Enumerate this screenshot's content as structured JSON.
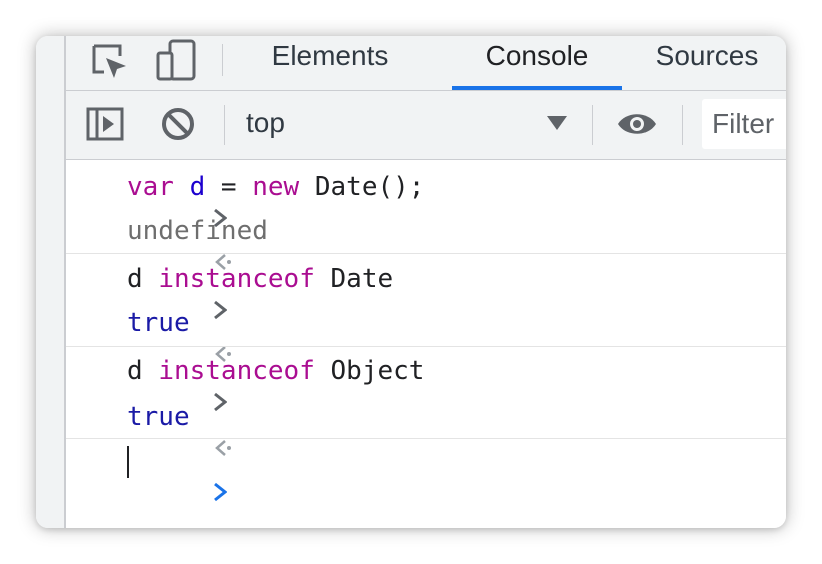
{
  "tabs": [
    {
      "label": "Elements"
    },
    {
      "label": "Console"
    },
    {
      "label": "Sources"
    }
  ],
  "toolbar": {
    "context": "top",
    "filter_placeholder": "Filter"
  },
  "console_lines": [
    {
      "type": "input",
      "tokens": [
        "var",
        " ",
        "d",
        " = ",
        "new",
        " Date();"
      ]
    },
    {
      "type": "output",
      "text": "undefined"
    },
    {
      "type": "input",
      "tokens": [
        "d",
        " ",
        "instanceof",
        " Date"
      ]
    },
    {
      "type": "output",
      "text": "true"
    },
    {
      "type": "input",
      "tokens": [
        "d",
        " ",
        "instanceof",
        " Object"
      ]
    },
    {
      "type": "output",
      "text": "true"
    }
  ],
  "icons": {
    "inspect": "inspect-element-icon",
    "device": "device-toolbar-icon",
    "sidebar": "show-sidebar-icon",
    "clear": "clear-console-icon",
    "eye": "live-expression-icon",
    "dropdown": "dropdown-arrow-icon",
    "input_prompt": "chevron-right-icon",
    "output_prompt": "return-arrow-icon"
  },
  "colors": {
    "accent": "#1a73e8",
    "keyword": "#aa0d91",
    "variable": "#1c00cf",
    "boolean": "#1a1aa6",
    "muted": "#6e6e6e"
  }
}
